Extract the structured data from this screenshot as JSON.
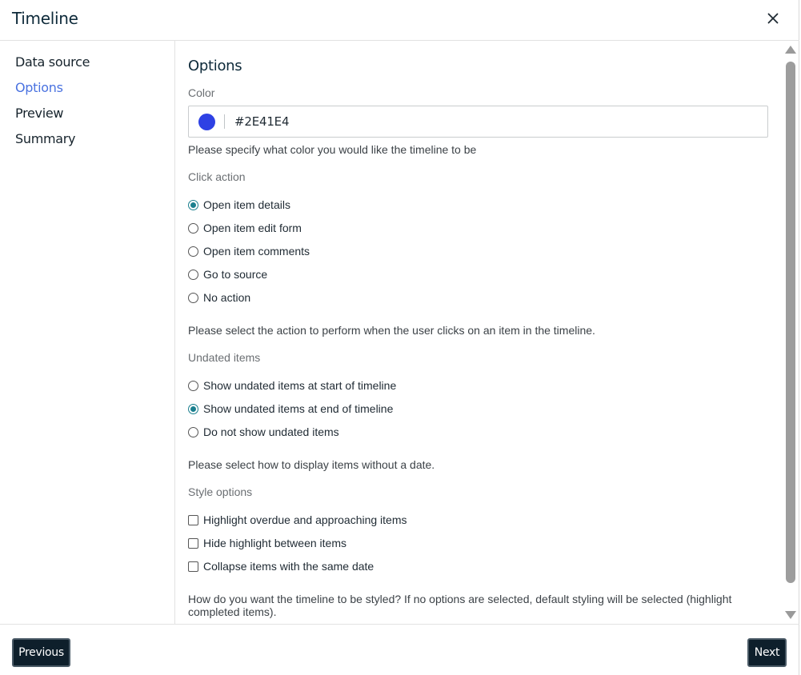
{
  "dialog": {
    "title": "Timeline"
  },
  "sidebar": {
    "items": [
      {
        "label": "Data source",
        "active": false
      },
      {
        "label": "Options",
        "active": true
      },
      {
        "label": "Preview",
        "active": false
      },
      {
        "label": "Summary",
        "active": false
      }
    ]
  },
  "options": {
    "title": "Options",
    "color": {
      "label": "Color",
      "value": "#2E41E4",
      "swatch_color": "#2E41E4",
      "help": "Please specify what color you would like the timeline to be"
    },
    "click_action": {
      "label": "Click action",
      "options": [
        {
          "label": "Open item details",
          "checked": true
        },
        {
          "label": "Open item edit form",
          "checked": false
        },
        {
          "label": "Open item comments",
          "checked": false
        },
        {
          "label": "Go to source",
          "checked": false
        },
        {
          "label": "No action",
          "checked": false
        }
      ],
      "help": "Please select the action to perform when the user clicks on an item in the timeline."
    },
    "undated_items": {
      "label": "Undated items",
      "options": [
        {
          "label": "Show undated items at start of timeline",
          "checked": false
        },
        {
          "label": "Show undated items at end of timeline",
          "checked": true
        },
        {
          "label": "Do not show undated items",
          "checked": false
        }
      ],
      "help": "Please select how to display items without a date."
    },
    "style_options": {
      "label": "Style options",
      "options": [
        {
          "label": "Highlight overdue and approaching items",
          "checked": false
        },
        {
          "label": "Hide highlight between items",
          "checked": false
        },
        {
          "label": "Collapse items with the same date",
          "checked": false
        }
      ],
      "help": "How do you want the timeline to be styled? If no options are selected, default styling will be selected (highlight completed items)."
    }
  },
  "footer": {
    "previous_label": "Previous",
    "next_label": "Next"
  },
  "colors": {
    "accent": "#4a72e0",
    "radio_checked": "#1a7f8e",
    "button_bg": "#0e1f2b"
  }
}
